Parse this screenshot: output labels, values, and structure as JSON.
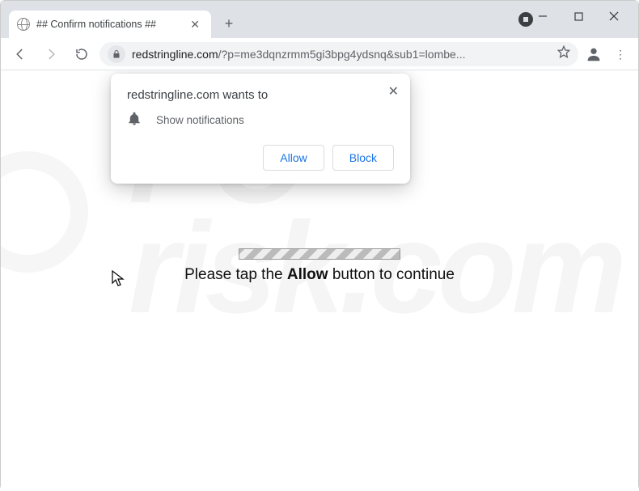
{
  "tab": {
    "title": "## Confirm notifications ##"
  },
  "omnibox": {
    "host": "redstringline.com",
    "path": "/?p=me3dqnzrmm5gi3bpg4ydsnq&sub1=lombe..."
  },
  "prompt": {
    "origin": "redstringline.com wants to",
    "permission": "Show notifications",
    "allow": "Allow",
    "block": "Block"
  },
  "page": {
    "msg_pre": "Please tap the ",
    "msg_bold": "Allow",
    "msg_post": " button to continue"
  },
  "watermark": {
    "line1": "PC",
    "line2": "risk.com"
  }
}
